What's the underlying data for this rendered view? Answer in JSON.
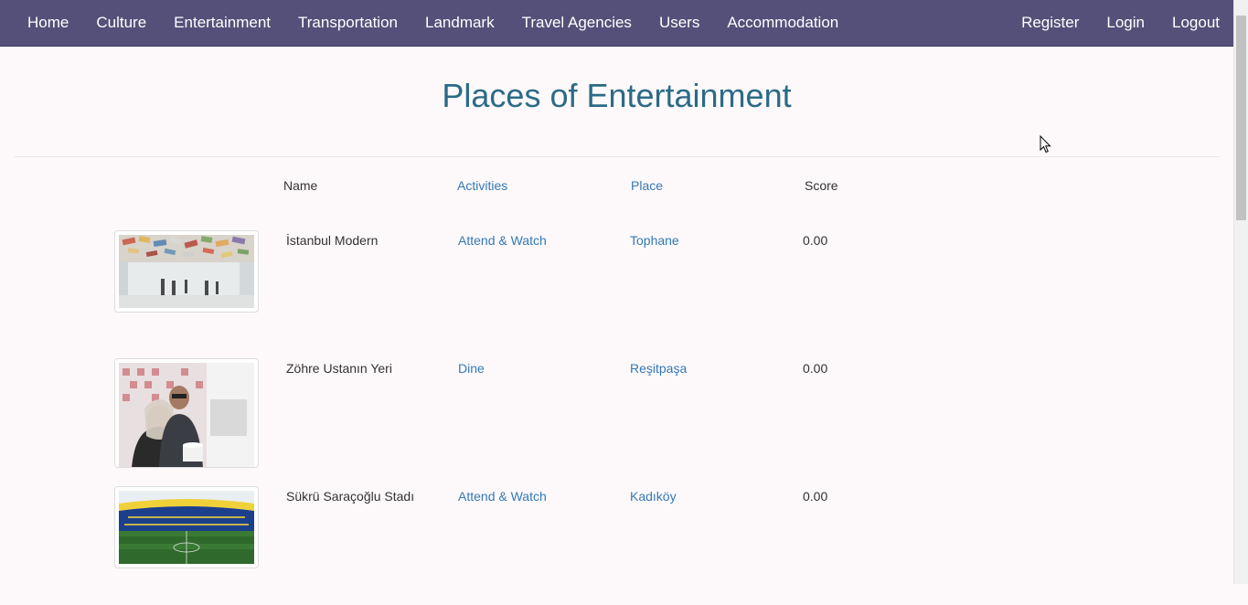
{
  "navbar": {
    "left_items": [
      "Home",
      "Culture",
      "Entertainment",
      "Transportation",
      "Landmark",
      "Travel Agencies",
      "Users",
      "Accommodation"
    ],
    "right_items": [
      "Register",
      "Login",
      "Logout"
    ]
  },
  "page": {
    "title": "Places of Entertainment"
  },
  "table": {
    "columns": [
      "Name",
      "Activities",
      "Place",
      "Score"
    ],
    "rows": [
      {
        "name": "İstanbul Modern",
        "activity": "Attend & Watch",
        "place": "Tophane",
        "score": "0.00",
        "image": "museum-interior-photo"
      },
      {
        "name": "Zöhre Ustanın Yeri",
        "activity": "Dine",
        "place": "Reşitpaşa",
        "score": "0.00",
        "image": "restaurant-people-photo"
      },
      {
        "name": "Sükrü Saraçoğlu Stadı",
        "activity": "Attend & Watch",
        "place": "Kadıköy",
        "score": "0.00",
        "image": "stadium-photo"
      }
    ]
  },
  "colors": {
    "navbar_bg": "#545079",
    "title": "#2a6b86",
    "link": "#337ab7",
    "background": "#fdf8fa"
  }
}
